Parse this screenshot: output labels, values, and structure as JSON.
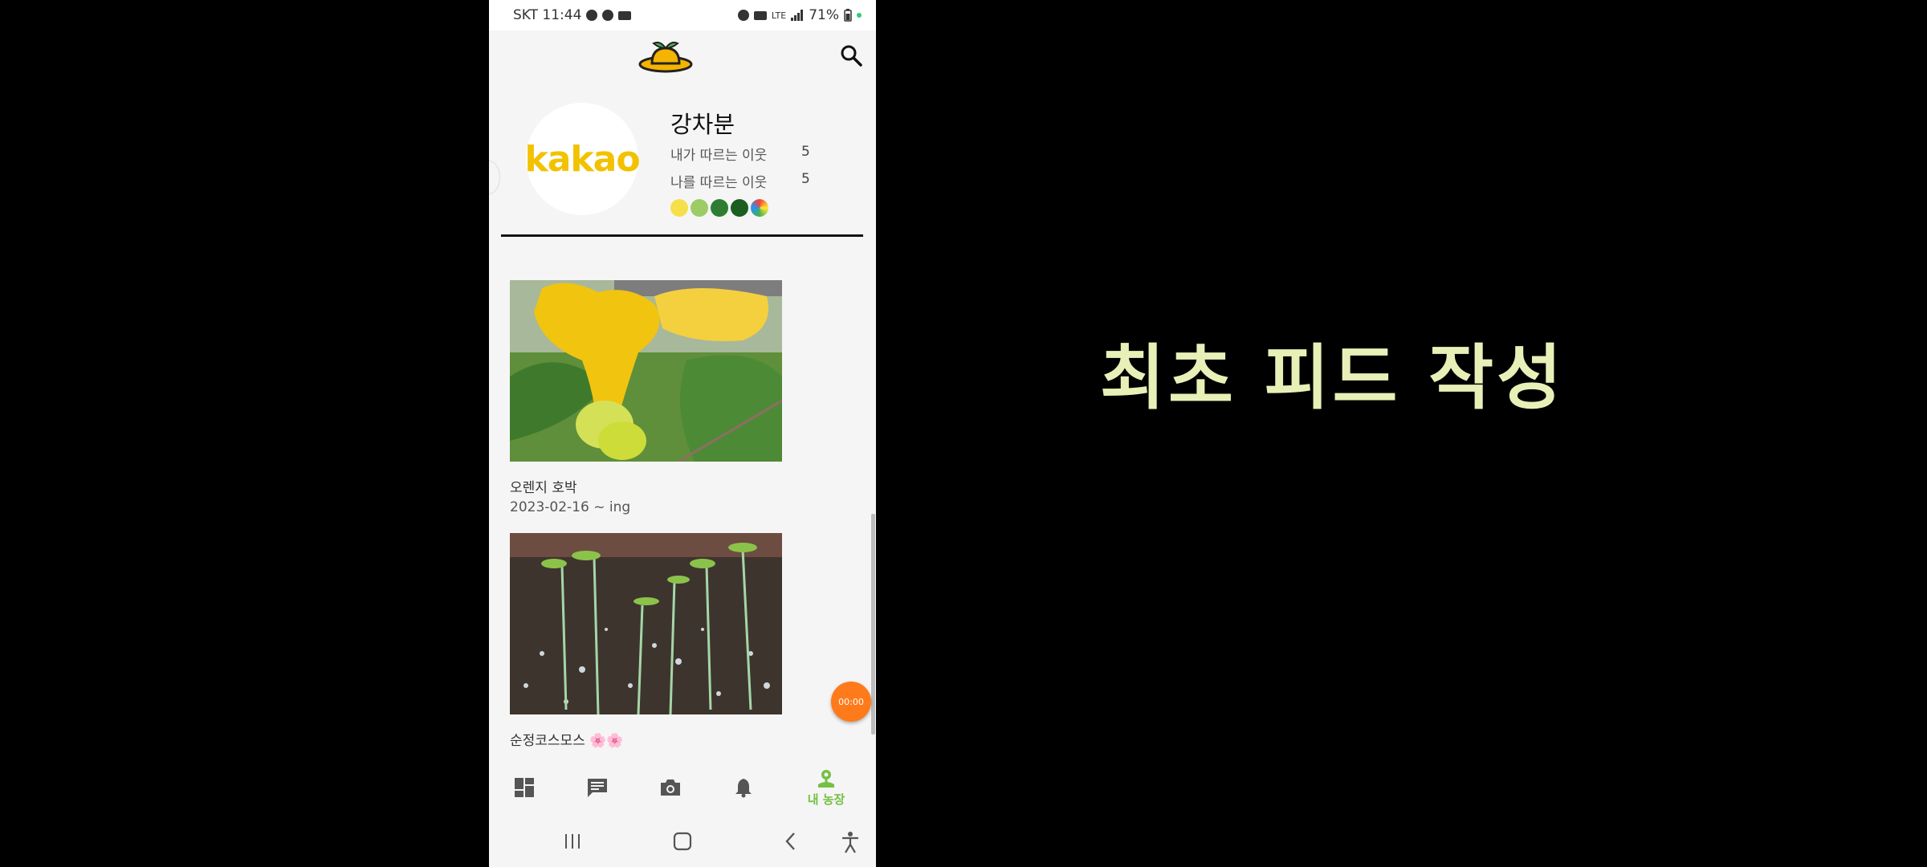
{
  "status_bar": {
    "carrier_time": "SKT 11:44",
    "network": "LTE",
    "battery": "71%"
  },
  "profile": {
    "avatar_text": "kakao",
    "name": "강차분",
    "following_label": "내가 따르는 이웃",
    "following_count": "5",
    "followers_label": "나를 따르는 이웃",
    "followers_count": "5"
  },
  "feed": [
    {
      "title": "오렌지 호박",
      "date": "2023-02-16 ~ ing"
    },
    {
      "title": "순정코스모스 🌸🌸"
    }
  ],
  "record_button": {
    "label": "00:00"
  },
  "bottom_nav": {
    "active_label": "내 농장"
  },
  "caption": "최초 피드 작성",
  "colors": {
    "accent_green": "#74c043",
    "record_orange": "#ff7a1a",
    "caption_color": "#e8f0b8"
  }
}
